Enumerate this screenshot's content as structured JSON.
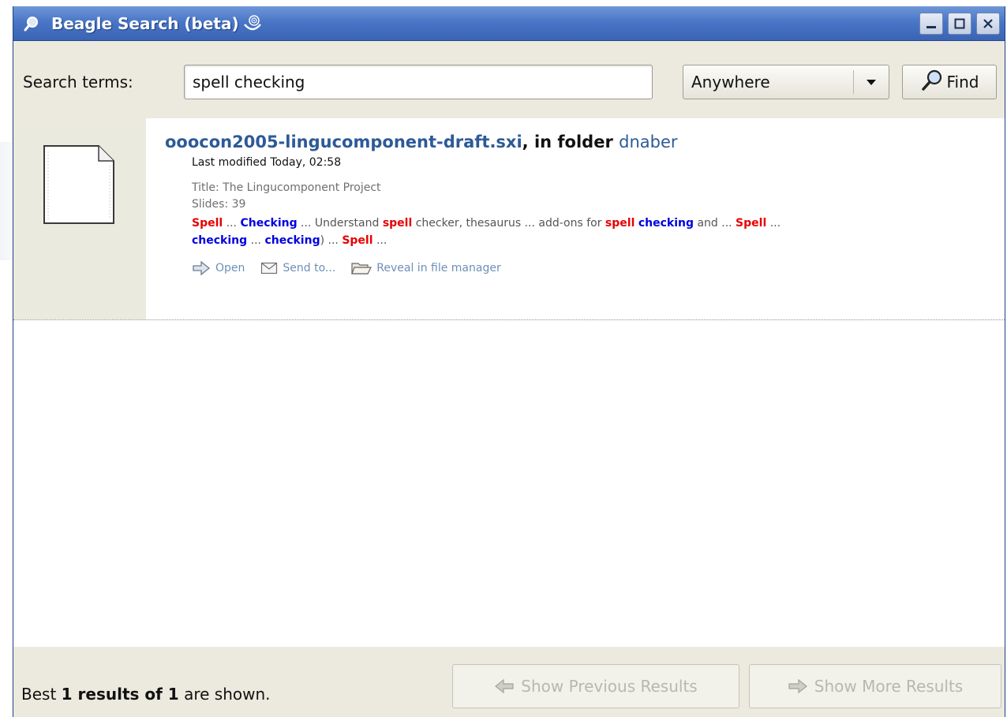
{
  "window": {
    "title": "Beagle Search (beta)"
  },
  "search": {
    "label": "Search terms:",
    "value": "spell checking",
    "scope": "Anywhere",
    "find_label": "Find"
  },
  "result": {
    "filename": "ooocon2005-lingucomponent-draft.sxi",
    "in_folder": ", in folder ",
    "folder": "dnaber",
    "modified": "Last modified Today, 02:58",
    "title_line": "Title: The Lingucomponent Project",
    "slides_line": "Slides: 39",
    "snippet": {
      "s1": "Spell",
      "s2": " ... ",
      "s3": "Checking",
      "s4": " ... Understand ",
      "s5": "spell",
      "s6": " checker, thesaurus ... add-ons for ",
      "s7": "spell",
      "s8": " ",
      "s9": "checking",
      "s10": " and ... ",
      "s11": "Spell",
      "s12": " ...",
      "s13": "checking",
      "s14": " ... ",
      "s15": "checking",
      "s16": ") ... ",
      "s17": "Spell",
      "s18": " ..."
    },
    "actions": {
      "open": "Open",
      "send": "Send to...",
      "reveal": "Reveal in file manager"
    }
  },
  "status": {
    "pre": "Best ",
    "bold": "1 results of 1",
    "post": " are shown.",
    "prev_label": "Show Previous Results",
    "next_label": "Show More Results"
  },
  "colors": {
    "titlebar": "#4a76c7",
    "link": "#2d5a98",
    "highlight_red": "#e80000",
    "highlight_blue": "#0000e0",
    "action": "#6d8fb8"
  }
}
